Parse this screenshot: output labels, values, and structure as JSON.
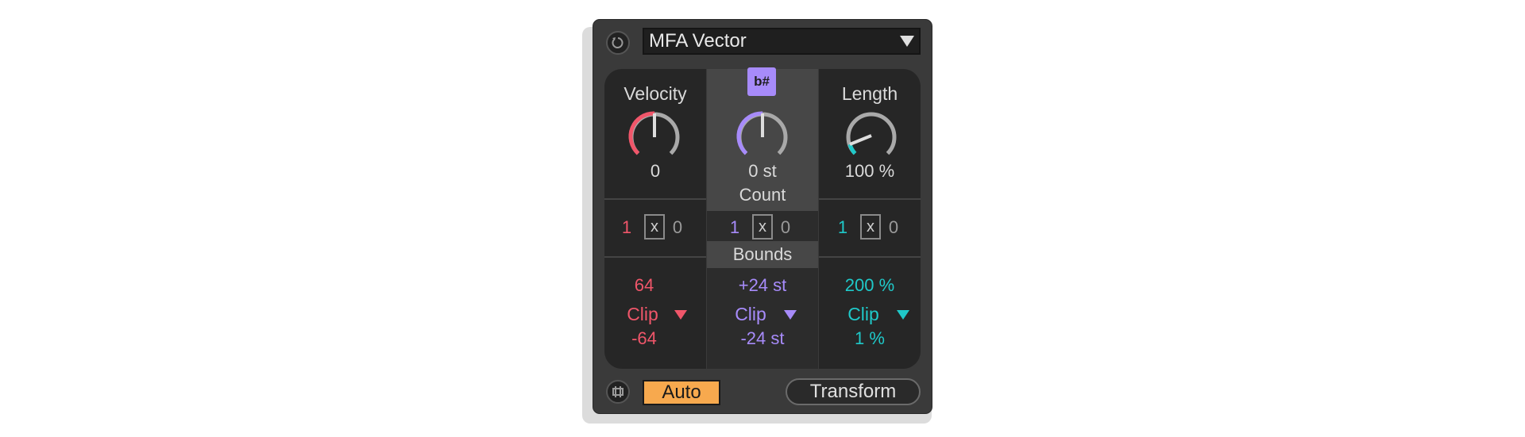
{
  "device": {
    "title": "MFA Vector",
    "colors": {
      "velocity": "#f0566a",
      "pitch": "#a78bfa",
      "length": "#1fc9c9",
      "auto": "#f7a94e"
    }
  },
  "icons": {
    "power": "power-icon",
    "dropdown": "triangle-down-icon",
    "key": "accidental-icon",
    "loop": "loop-icon"
  },
  "velocity": {
    "label": "Velocity",
    "value": "0",
    "count": "1",
    "x": "x",
    "zero": "0",
    "max": "64",
    "mode": "Clip",
    "min": "-64"
  },
  "pitch": {
    "key_label": "b#",
    "value": "0 st",
    "count_label": "Count",
    "count": "1",
    "x": "x",
    "zero": "0",
    "bounds_label": "Bounds",
    "max": "+24 st",
    "mode": "Clip",
    "min": "-24 st"
  },
  "length": {
    "label": "Length",
    "value": "100 %",
    "count": "1",
    "x": "x",
    "zero": "0",
    "max": "200 %",
    "mode": "Clip",
    "min": "1 %"
  },
  "footer": {
    "auto_label": "Auto",
    "transform_label": "Transform"
  }
}
